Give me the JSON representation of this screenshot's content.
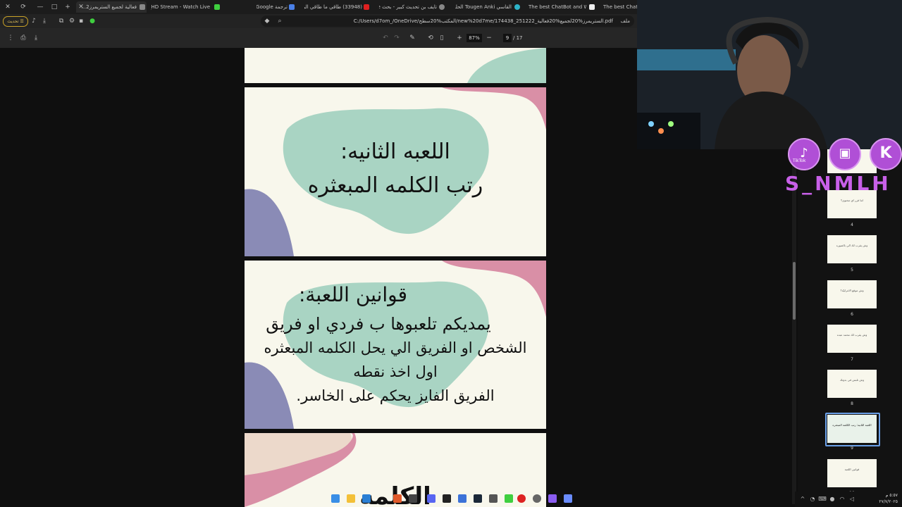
{
  "browser": {
    "tabs": [
      {
        "label": "The best ChatBot",
        "color": "#eeeeee"
      },
      {
        "label": "The best ChatBot and Widgets",
        "color": "#eeeeee"
      },
      {
        "label": "القاسي Tougen Anki الحلقة 23 مـ...",
        "color": "#2db3c8"
      },
      {
        "label": "تايف بن تحديث كبير - بحث Google",
        "color": "#888888"
      },
      {
        "label": "(33948) طاقي ما طاقي الرجاء مـ...",
        "color": "#e02020"
      },
      {
        "label": "ترجمة Google",
        "color": "#4a80e8"
      },
      {
        "label": "moaz_HD Stream - Watch Live",
        "color": "#3fcf3f"
      },
      {
        "label": "فعالية لجميع الستريمرز2...",
        "color": "#888888"
      }
    ],
    "update_label": "تحديث",
    "url": "C:/Users/d7om_/OneDrive/المكتب%20سطح/new%20d7me/174438_251222_الستريمرز%20لجميع%20فعالية.pdf",
    "file_label": "ملف"
  },
  "pdf": {
    "zoom": "87%",
    "page": "9",
    "total": "/ 17"
  },
  "slides": {
    "game2_line1": "اللعبه الثانيه:",
    "game2_line2": "رتب الكلمه المبعثره",
    "rules_title": "قوانين اللعبة:",
    "rules_line1": "يمديكم تلعبوها ب فردي او فريق",
    "rules_line2": "الشخص او الفريق الي يحل الكلمه المبعثره",
    "rules_line3": "اول اخذ نقطه",
    "rules_line4": "الفريق الفايز يحكم على الخاسر.",
    "partial_text": "الكلمه"
  },
  "thumbnails": [
    {
      "num": "4",
      "text": "انتا قرر اي محتوى؟"
    },
    {
      "num": "5",
      "text": "وش يقرب لك الي بالصوره"
    },
    {
      "num": "6",
      "text": "وش موقع الاغرابيّة؟"
    },
    {
      "num": "7",
      "text": "وش يقرب لك محمد عبده"
    },
    {
      "num": "8",
      "text": "وش تلبس في بدوتك"
    },
    {
      "num": "9",
      "text": "اللعبه الثانيه: رتب الكلمه المبعثره"
    },
    {
      "num": "10",
      "text": "قوانين اللعبة"
    }
  ],
  "overlay": {
    "tiktok_label": "TikTok",
    "twitch_icon": "twitch-icon",
    "kick_letter": "K",
    "handle": "S_NMLH"
  },
  "taskbar": {
    "time": "٥:٥٧ م",
    "date": "٢٧/٧/٢٠٢٥"
  },
  "colors": {
    "slide_bg": "#f8f7ec",
    "blob_green": "#a9d4c3",
    "blob_pink": "#d98fa6",
    "blob_purple": "#8a8bb6",
    "accent_purple": "#b04fd6"
  }
}
